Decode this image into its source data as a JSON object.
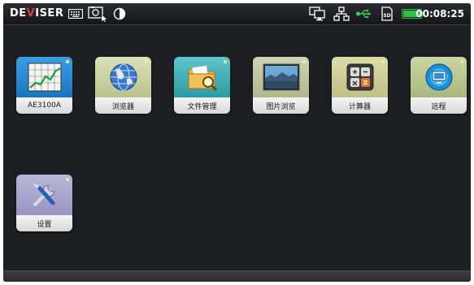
{
  "statusbar": {
    "brand_left": "DE",
    "brand_accent": "V",
    "brand_right": "ISER",
    "time": "00:08:25",
    "battery_color": "#2fc04a",
    "usb_color": "#3fcf5a",
    "icons": [
      "keyboard-icon",
      "screenshot-icon",
      "contrast-icon",
      "monitor-icon",
      "network-icon",
      "usb-icon",
      "sd-card-icon",
      "battery-icon"
    ]
  },
  "apps": [
    {
      "id": "ae3100a",
      "label": "AE3100A",
      "color": "#2a8fd6",
      "icon": "chart-icon"
    },
    {
      "id": "browser",
      "label": "浏览器",
      "color": "#c9d2a8",
      "icon": "globe-icon"
    },
    {
      "id": "file-manager",
      "label": "文件管理",
      "color": "#4ab6bd",
      "icon": "folder-search-icon"
    },
    {
      "id": "image-viewer",
      "label": "图片浏览",
      "color": "#c3c8a6",
      "icon": "landscape-icon"
    },
    {
      "id": "calculator",
      "label": "计算器",
      "color": "#cfcf9d",
      "icon": "calculator-icon"
    },
    {
      "id": "remote",
      "label": "远程",
      "color": "#bccb98",
      "icon": "remote-icon"
    },
    {
      "id": "settings",
      "label": "设置",
      "color": "#aeaace",
      "icon": "tools-icon"
    }
  ]
}
